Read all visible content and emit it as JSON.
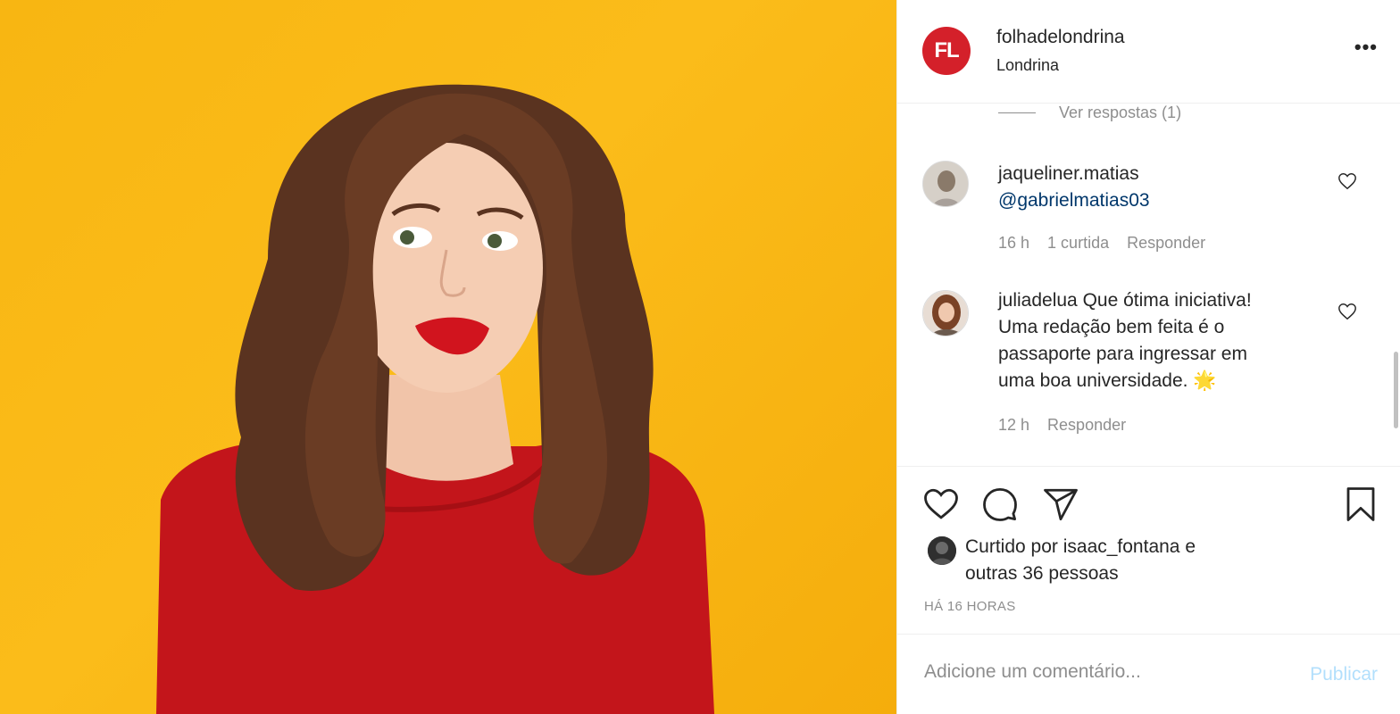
{
  "post": {
    "image_alt_icon": "photo-woman-biting-lip"
  },
  "header": {
    "logo_text": "FL",
    "username": "folhadelondrina",
    "location": "Londrina",
    "more_icon": "more-options-icon"
  },
  "comments": {
    "view_replies": "Ver respostas (1)",
    "items": [
      {
        "username": "jaqueliner.matias",
        "mention": "@gabrielmatias03",
        "time": "16 h",
        "likes": "1 curtida",
        "reply": "Responder"
      },
      {
        "username": "juliadelua",
        "text_line1": "Que ótima iniciativa!",
        "text_line2": "Uma redação bem feita é o",
        "text_line3": "passaporte para ingressar em",
        "text_line4": "uma boa universidade. 🌟",
        "time": "12 h",
        "reply": "Responder"
      }
    ]
  },
  "actions": {
    "like_icon": "heart-icon",
    "comment_icon": "comment-icon",
    "share_icon": "share-icon",
    "save_icon": "bookmark-icon"
  },
  "likes": {
    "prefix": "Curtido por ",
    "user": "isaac_fontana",
    "suffix_line1": " e",
    "line2": "outras 36 pessoas"
  },
  "timestamp": "HÁ 16 HORAS",
  "add_comment": {
    "placeholder": "Adicione um comentário...",
    "publish": "Publicar"
  },
  "colors": {
    "background_yellow": "#f8b612",
    "brand_red": "#d4202a",
    "sweater_red": "#c0141a",
    "mention_blue": "#00376b",
    "publish_disabled": "#b2dffc"
  }
}
